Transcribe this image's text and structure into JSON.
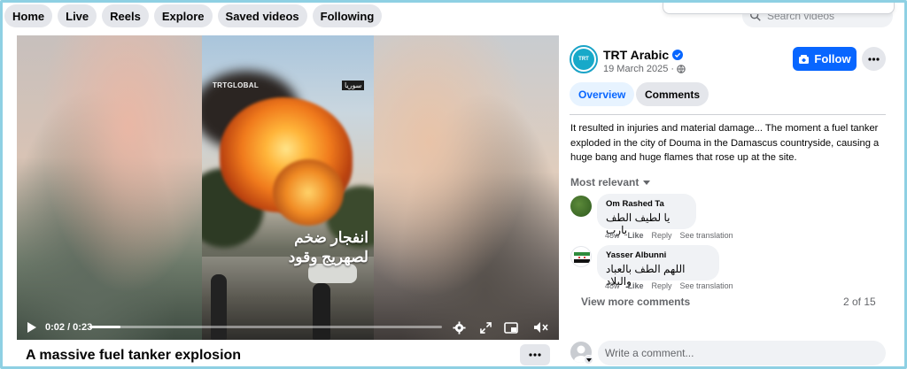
{
  "nav": {
    "items": [
      {
        "label": "Home"
      },
      {
        "label": "Live"
      },
      {
        "label": "Reels"
      },
      {
        "label": "Explore"
      },
      {
        "label": "Saved videos"
      },
      {
        "label": "Following"
      }
    ],
    "search_placeholder": "Search videos"
  },
  "video": {
    "watermark": "TRTGLOBAL",
    "watermark_ar": "سوريا",
    "caption_line1": "انفجار ضخم",
    "caption_line2": "لصهريج وقود",
    "time": "0:02 / 0:23",
    "progress": 0.087,
    "title": "A massive fuel tanker explosion"
  },
  "page": {
    "name": "TRT Arabic",
    "avatar_text": "TRT",
    "date": "19 March 2025 ·",
    "follow_label": "Follow"
  },
  "tabs": [
    {
      "label": "Overview",
      "active": true
    },
    {
      "label": "Comments",
      "active": false
    }
  ],
  "description": "It resulted in injuries and material damage... The moment a fuel tanker exploded in the city of Douma in the Damascus countryside, causing a huge bang and huge flames that rose up at the site.",
  "sort_label": "Most relevant",
  "comments": [
    {
      "author": "Om Rashed Ta",
      "text": "يا لطيف الطف يارب",
      "age": "48w",
      "like": "Like",
      "reply": "Reply",
      "translate": "See translation"
    },
    {
      "author": "Yasser Albunni",
      "text": "اللهم الطف بالعباد والبلاد",
      "age": "48w",
      "like": "Like",
      "reply": "Reply",
      "translate": "See translation"
    }
  ],
  "view_more": "View more comments",
  "count": "2 of 15",
  "composer_placeholder": "Write a comment...",
  "colors": {
    "accent": "#0866ff",
    "frame": "#8ed0e3",
    "brand": "#17a9c9"
  }
}
